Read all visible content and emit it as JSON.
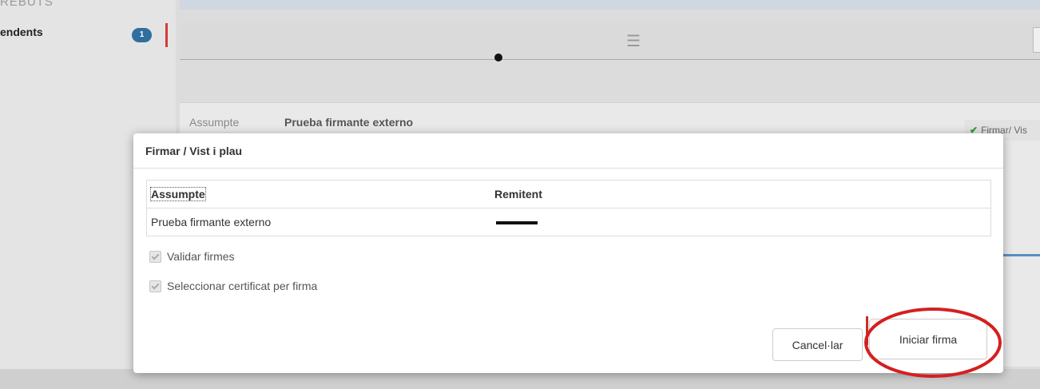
{
  "background": {
    "sidebar_top_text": "REBUTS",
    "sidebar_item_label": "endents",
    "sidebar_item_count": "1",
    "subject_label": "Assumpte",
    "subject_value": "Prueba firmante externo",
    "sign_tag_label": "Firmar/ Vis"
  },
  "modal": {
    "title": "Firmar / Vist i plau",
    "table": {
      "headers": [
        "Assumpte",
        "Remitent"
      ],
      "rows": [
        {
          "assumpte": "Prueba firmante externo",
          "remitent": ""
        }
      ]
    },
    "checkboxes": [
      {
        "label": "Validar firmes",
        "checked": true,
        "disabled": true
      },
      {
        "label": "Seleccionar certificat per firma",
        "checked": true,
        "disabled": true
      }
    ],
    "buttons": {
      "cancel": "Cancel·lar",
      "start": "Iniciar firma"
    }
  },
  "colors": {
    "annotation": "#d42020",
    "badge": "#2f6fa0",
    "check_green": "#2e9d3b"
  }
}
